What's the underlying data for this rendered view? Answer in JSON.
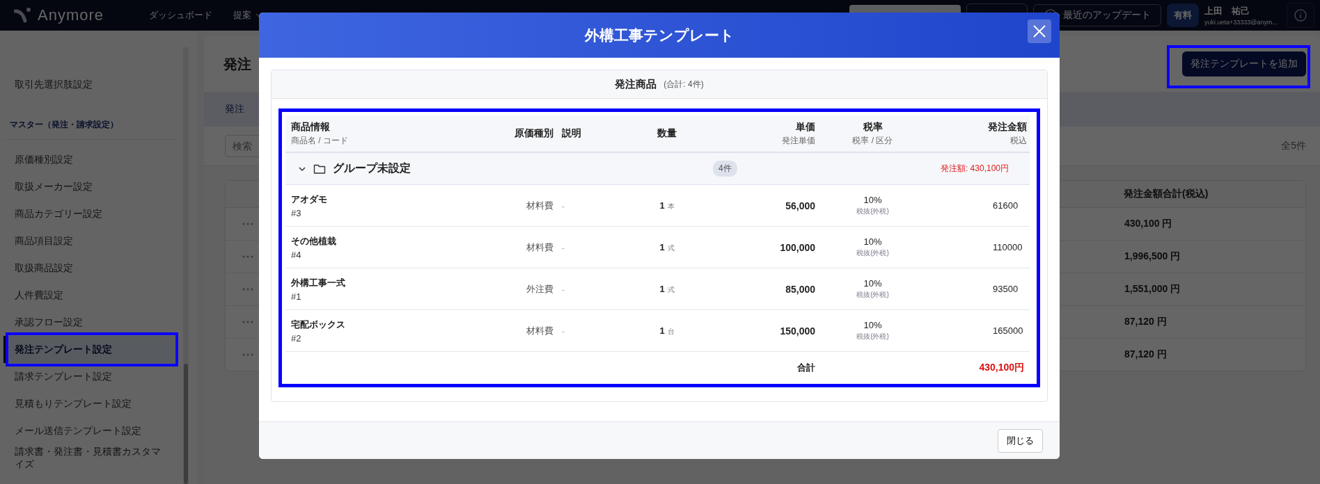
{
  "topbar": {
    "logo": "Anymore",
    "nav": [
      {
        "label": "ダッシュボード",
        "kind": "link"
      },
      {
        "label": "提案",
        "kind": "dropdown"
      }
    ],
    "updates_button": "最近のアップデート",
    "plan_badge": "有料",
    "user": {
      "name": "上田　祐己",
      "email": "yuki.ueta+33333@anym..."
    }
  },
  "sidebar": {
    "items": [
      {
        "label": "取引先選択肢設定",
        "selected": false
      }
    ],
    "section": {
      "title": "マスター（発注・請求設定）",
      "items": [
        {
          "label": "原価種別設定",
          "selected": false
        },
        {
          "label": "取扱メーカー設定",
          "selected": false
        },
        {
          "label": "商品カテゴリー設定",
          "selected": false
        },
        {
          "label": "商品項目設定",
          "selected": false
        },
        {
          "label": "取扱商品設定",
          "selected": false
        },
        {
          "label": "人件費設定",
          "selected": false
        },
        {
          "label": "承認フロー設定",
          "selected": false
        },
        {
          "label": "発注テンプレート設定",
          "selected": true
        },
        {
          "label": "請求テンプレート設定",
          "selected": false
        },
        {
          "label": "見積もりテンプレート設定",
          "selected": false
        },
        {
          "label": "メール送信テンプレート設定",
          "selected": false
        },
        {
          "label": "請求書・発注書・見積書カスタマイズ",
          "selected": false
        }
      ]
    }
  },
  "main": {
    "title": "発注",
    "add_button": "発注テンプレートを追加",
    "tab": "発注",
    "search": {
      "placeholder": "検索"
    },
    "count": "全5件",
    "column": "発注金額合計(税込)",
    "rows": [
      {
        "amount": "430,100 円"
      },
      {
        "amount": "1,996,500 円"
      },
      {
        "amount": "1,551,000 円"
      },
      {
        "amount": "87,120 円"
      },
      {
        "amount": "87,120 円"
      }
    ]
  },
  "modal": {
    "title": "外構工事テンプレート",
    "section_title": "発注商品",
    "section_count": "(合計: 4件)",
    "columns": [
      {
        "label": "商品情報",
        "sub": "商品名 / コード"
      },
      {
        "label": "原価種別"
      },
      {
        "label": "説明"
      },
      {
        "label": "数量"
      },
      {
        "label": "単価",
        "sub": "発注単価"
      },
      {
        "label": "税率",
        "sub": "税率 / 区分"
      },
      {
        "label": "発注金額",
        "sub": "税込"
      }
    ],
    "group": {
      "name": "グループ未設定",
      "count": "4件",
      "total": "発注額: 430,100円",
      "expanded": true
    },
    "items": [
      {
        "name": "アオダモ",
        "code": "#3",
        "cost_type": "材料費",
        "description": "-",
        "qty": "1",
        "unit": "本",
        "price": "56,000",
        "tax": "10%",
        "tax_kind": "税抜(外税)",
        "amount": "61600"
      },
      {
        "name": "その他植栽",
        "code": "#4",
        "cost_type": "材料費",
        "description": "-",
        "qty": "1",
        "unit": "式",
        "price": "100,000",
        "tax": "10%",
        "tax_kind": "税抜(外税)",
        "amount": "110000"
      },
      {
        "name": "外構工事一式",
        "code": "#1",
        "cost_type": "外注費",
        "description": "-",
        "qty": "1",
        "unit": "式",
        "price": "85,000",
        "tax": "10%",
        "tax_kind": "税抜(外税)",
        "amount": "93500"
      },
      {
        "name": "宅配ボックス",
        "code": "#2",
        "cost_type": "材料費",
        "description": "-",
        "qty": "1",
        "unit": "台",
        "price": "150,000",
        "tax": "10%",
        "tax_kind": "税抜(外税)",
        "amount": "165000"
      }
    ],
    "total_label": "合計",
    "total_value": "430,100円",
    "close_button": "閉じる"
  }
}
